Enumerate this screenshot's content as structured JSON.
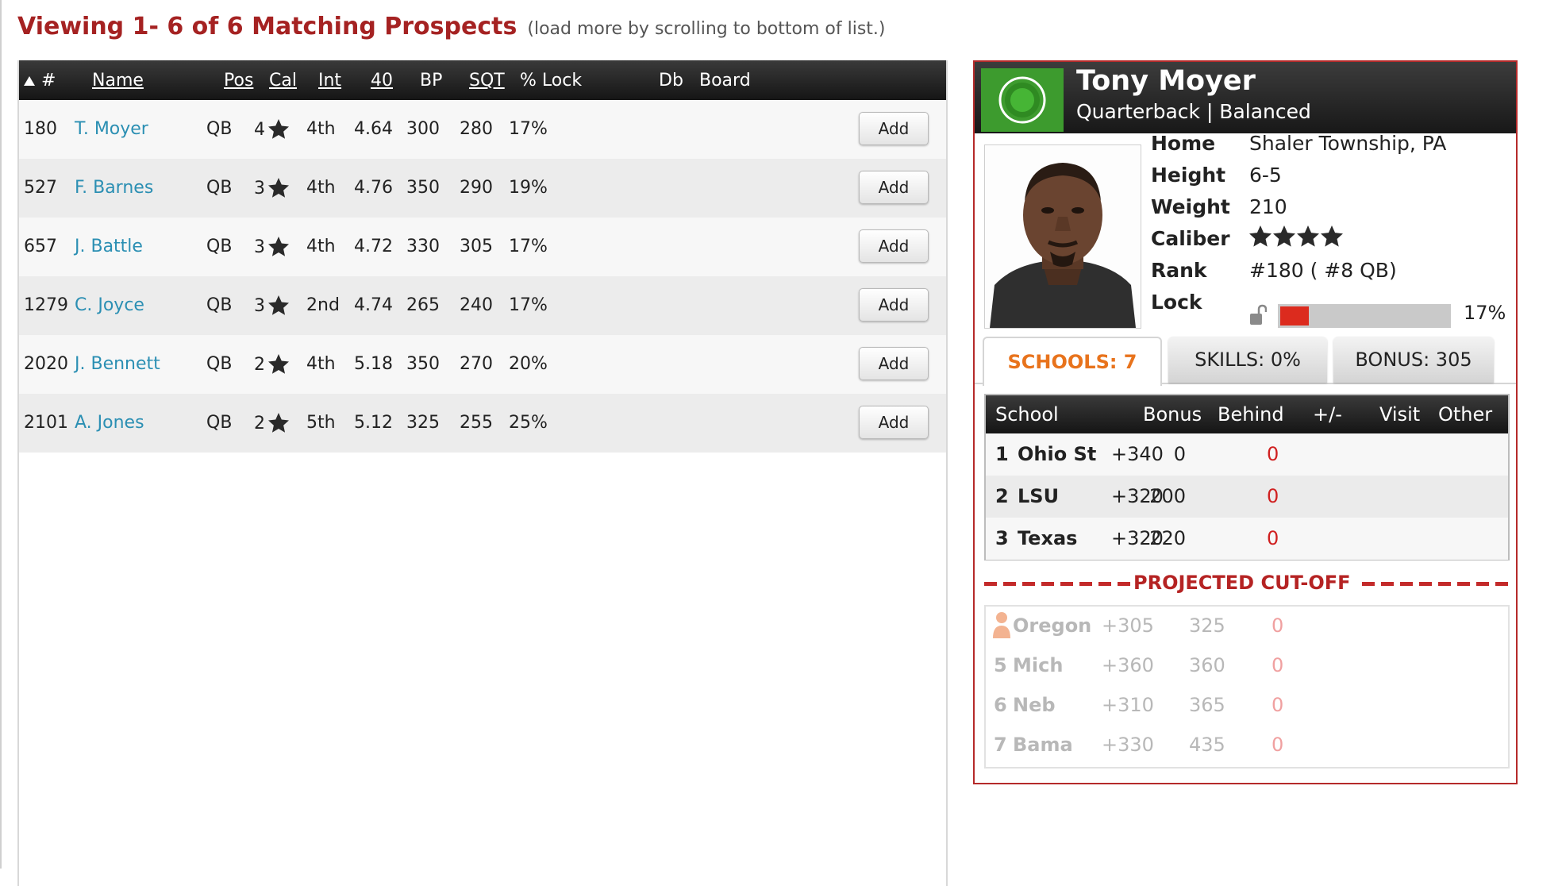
{
  "heading": {
    "title": "Viewing 1- 6 of 6 Matching Prospects",
    "note": "(load more by scrolling to bottom of list.)"
  },
  "table": {
    "headers": {
      "num": "#",
      "name": "Name",
      "pos": "Pos",
      "cal": "Cal",
      "int": "Int",
      "forty": "40",
      "bp": "BP",
      "sqt": "SQT",
      "lock": "% Lock",
      "db": "Db",
      "board": "Board"
    },
    "sort_indicator": "sort-ascending-icon",
    "rows": [
      {
        "num": "180",
        "name": "T. Moyer",
        "pos": "QB",
        "cal": "4",
        "int": "4th",
        "forty": "4.64",
        "bp": "300",
        "sqt": "280",
        "lock": "17%",
        "action": "Add"
      },
      {
        "num": "527",
        "name": "F. Barnes",
        "pos": "QB",
        "cal": "3",
        "int": "4th",
        "forty": "4.76",
        "bp": "350",
        "sqt": "290",
        "lock": "19%",
        "action": "Add"
      },
      {
        "num": "657",
        "name": "J. Battle",
        "pos": "QB",
        "cal": "3",
        "int": "4th",
        "forty": "4.72",
        "bp": "330",
        "sqt": "305",
        "lock": "17%",
        "action": "Add"
      },
      {
        "num": "1279",
        "name": "C. Joyce",
        "pos": "QB",
        "cal": "3",
        "int": "2nd",
        "forty": "4.74",
        "bp": "265",
        "sqt": "240",
        "lock": "17%",
        "action": "Add"
      },
      {
        "num": "2020",
        "name": "J. Bennett",
        "pos": "QB",
        "cal": "2",
        "int": "4th",
        "forty": "5.18",
        "bp": "350",
        "sqt": "270",
        "lock": "20%",
        "action": "Add"
      },
      {
        "num": "2101",
        "name": "A. Jones",
        "pos": "QB",
        "cal": "2",
        "int": "5th",
        "forty": "5.12",
        "bp": "325",
        "sqt": "255",
        "lock": "25%",
        "action": "Add"
      }
    ]
  },
  "player": {
    "name": "Tony Moyer",
    "subtitle": "Quarterback | Balanced",
    "labels": {
      "home": "Home",
      "height": "Height",
      "weight": "Weight",
      "caliber": "Caliber",
      "rank": "Rank",
      "lock": "Lock"
    },
    "home": "Shaler Township, PA",
    "height": "6-5",
    "weight": "210",
    "caliber_stars": 4,
    "rank": "#180 ( #8 QB)",
    "lock_pct": "17%",
    "lock_value": 0.17
  },
  "tabs": [
    {
      "label": "SCHOOLS: 7",
      "active": true
    },
    {
      "label": "SKILLS: 0%",
      "active": false
    },
    {
      "label": "BONUS: 305",
      "active": false
    }
  ],
  "schools": {
    "headers": {
      "school": "School",
      "bonus": "Bonus",
      "behind": "Behind",
      "delta": "+/-",
      "visit": "Visit",
      "other": "Other"
    },
    "rows": [
      {
        "rank": "1",
        "school": "Ohio St",
        "bonus": "+340",
        "behind": "0",
        "delta": "0"
      },
      {
        "rank": "2",
        "school": "LSU",
        "bonus": "+320",
        "behind": "200",
        "delta": "0"
      },
      {
        "rank": "3",
        "school": "Texas",
        "bonus": "+320",
        "behind": "220",
        "delta": "0"
      }
    ],
    "cutoff_label": "PROJECTED CUT-OFF",
    "below": [
      {
        "rank": "",
        "school": "Oregon",
        "bonus": "+305",
        "behind": "325",
        "delta": "0",
        "icon": "user-icon"
      },
      {
        "rank": "5",
        "school": "Mich",
        "bonus": "+360",
        "behind": "360",
        "delta": "0"
      },
      {
        "rank": "6",
        "school": "Neb",
        "bonus": "+310",
        "behind": "365",
        "delta": "0"
      },
      {
        "rank": "7",
        "school": "Bama",
        "bonus": "+330",
        "behind": "435",
        "delta": "0"
      }
    ]
  },
  "colors": {
    "heading": "#a52222",
    "link": "#2b8fb3",
    "badge": "#3d9b2e",
    "lock_fill": "#dc2b1e",
    "tab_active": "#e8731c"
  }
}
